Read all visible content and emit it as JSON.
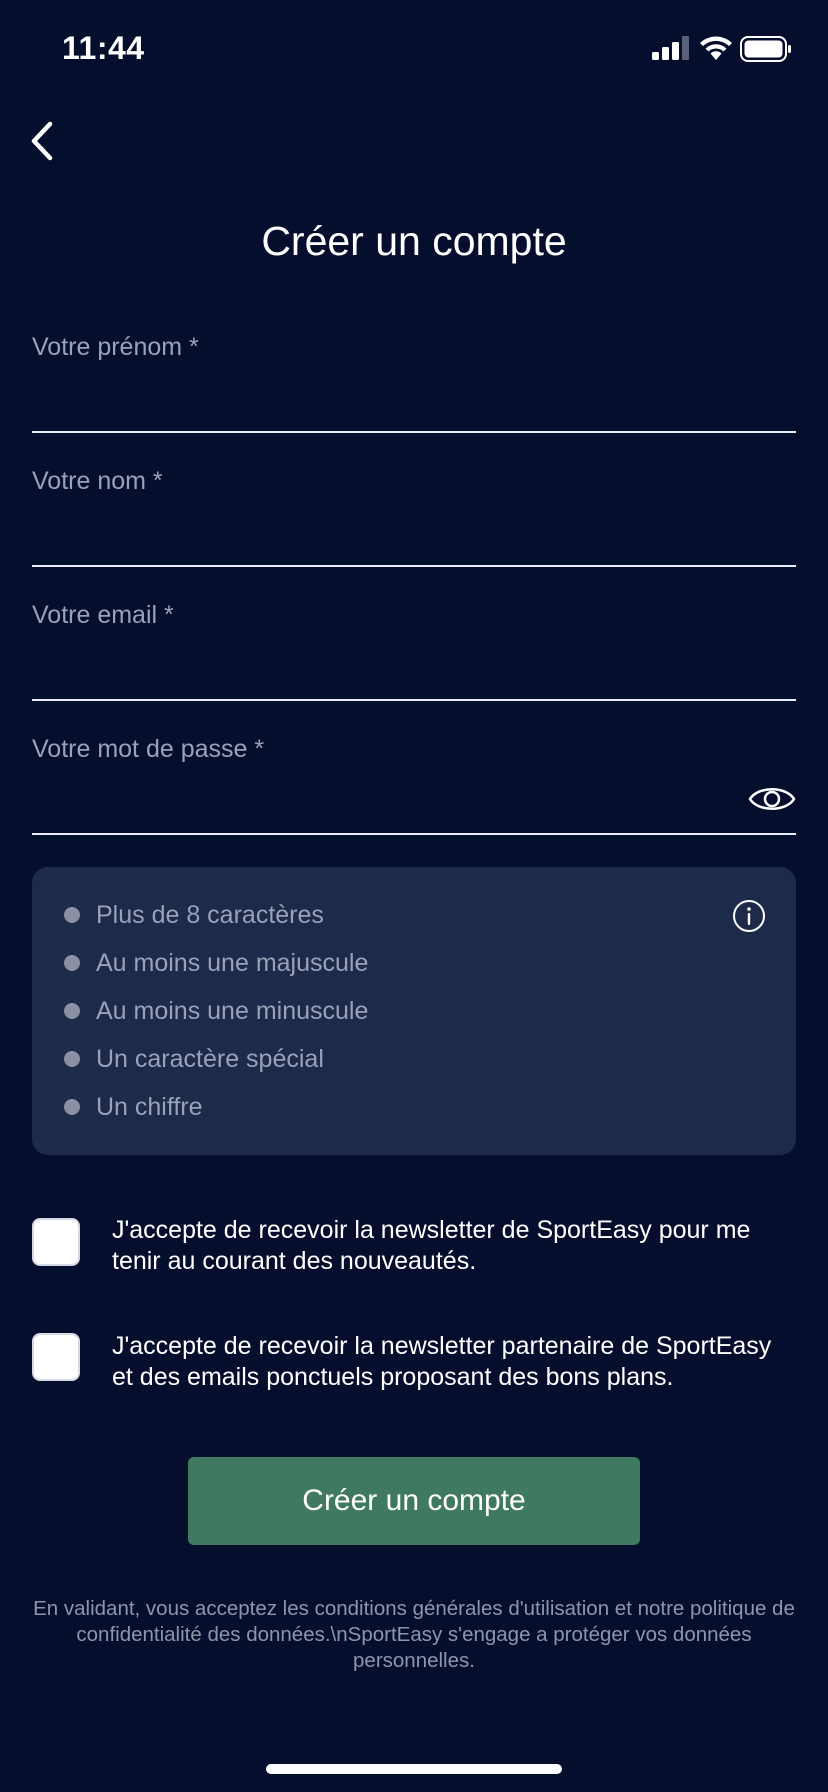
{
  "status_bar": {
    "time": "11:44",
    "icons": [
      "cellular-signal-icon",
      "wifi-icon",
      "battery-icon"
    ]
  },
  "nav": {
    "back_icon": "chevron-left-icon"
  },
  "title": "Créer un compte",
  "form": {
    "first_name": {
      "label": "Votre prénom *",
      "value": ""
    },
    "last_name": {
      "label": "Votre nom *",
      "value": ""
    },
    "email": {
      "label": "Votre email *",
      "value": ""
    },
    "password": {
      "label": "Votre mot de passe *",
      "value": "",
      "toggle_icon": "eye-icon"
    }
  },
  "password_rules": {
    "info_icon": "info-icon",
    "items": [
      {
        "text": "Plus de 8 caractères"
      },
      {
        "text": "Au moins une majuscule"
      },
      {
        "text": "Au moins une minuscule"
      },
      {
        "text": "Un caractère spécial"
      },
      {
        "text": "Un chiffre"
      }
    ]
  },
  "consents": [
    {
      "text": "J'accepte de recevoir la newsletter de SportEasy pour me tenir au courant des nouveautés.",
      "checked": false
    },
    {
      "text": "J'accepte de recevoir la newsletter partenaire de SportEasy et des emails ponctuels proposant des bons plans.",
      "checked": false
    }
  ],
  "submit_label": "Créer un compte",
  "legal_text": "En validant, vous acceptez les conditions générales d'utilisation et notre politique de confidentialité des données.\\nSportEasy s'engage a protéger vos données personnelles.",
  "colors": {
    "background": "#060e2e",
    "panel": "#1e2a4a",
    "button": "#3f7a60",
    "muted_text": "#9aa1b8"
  }
}
